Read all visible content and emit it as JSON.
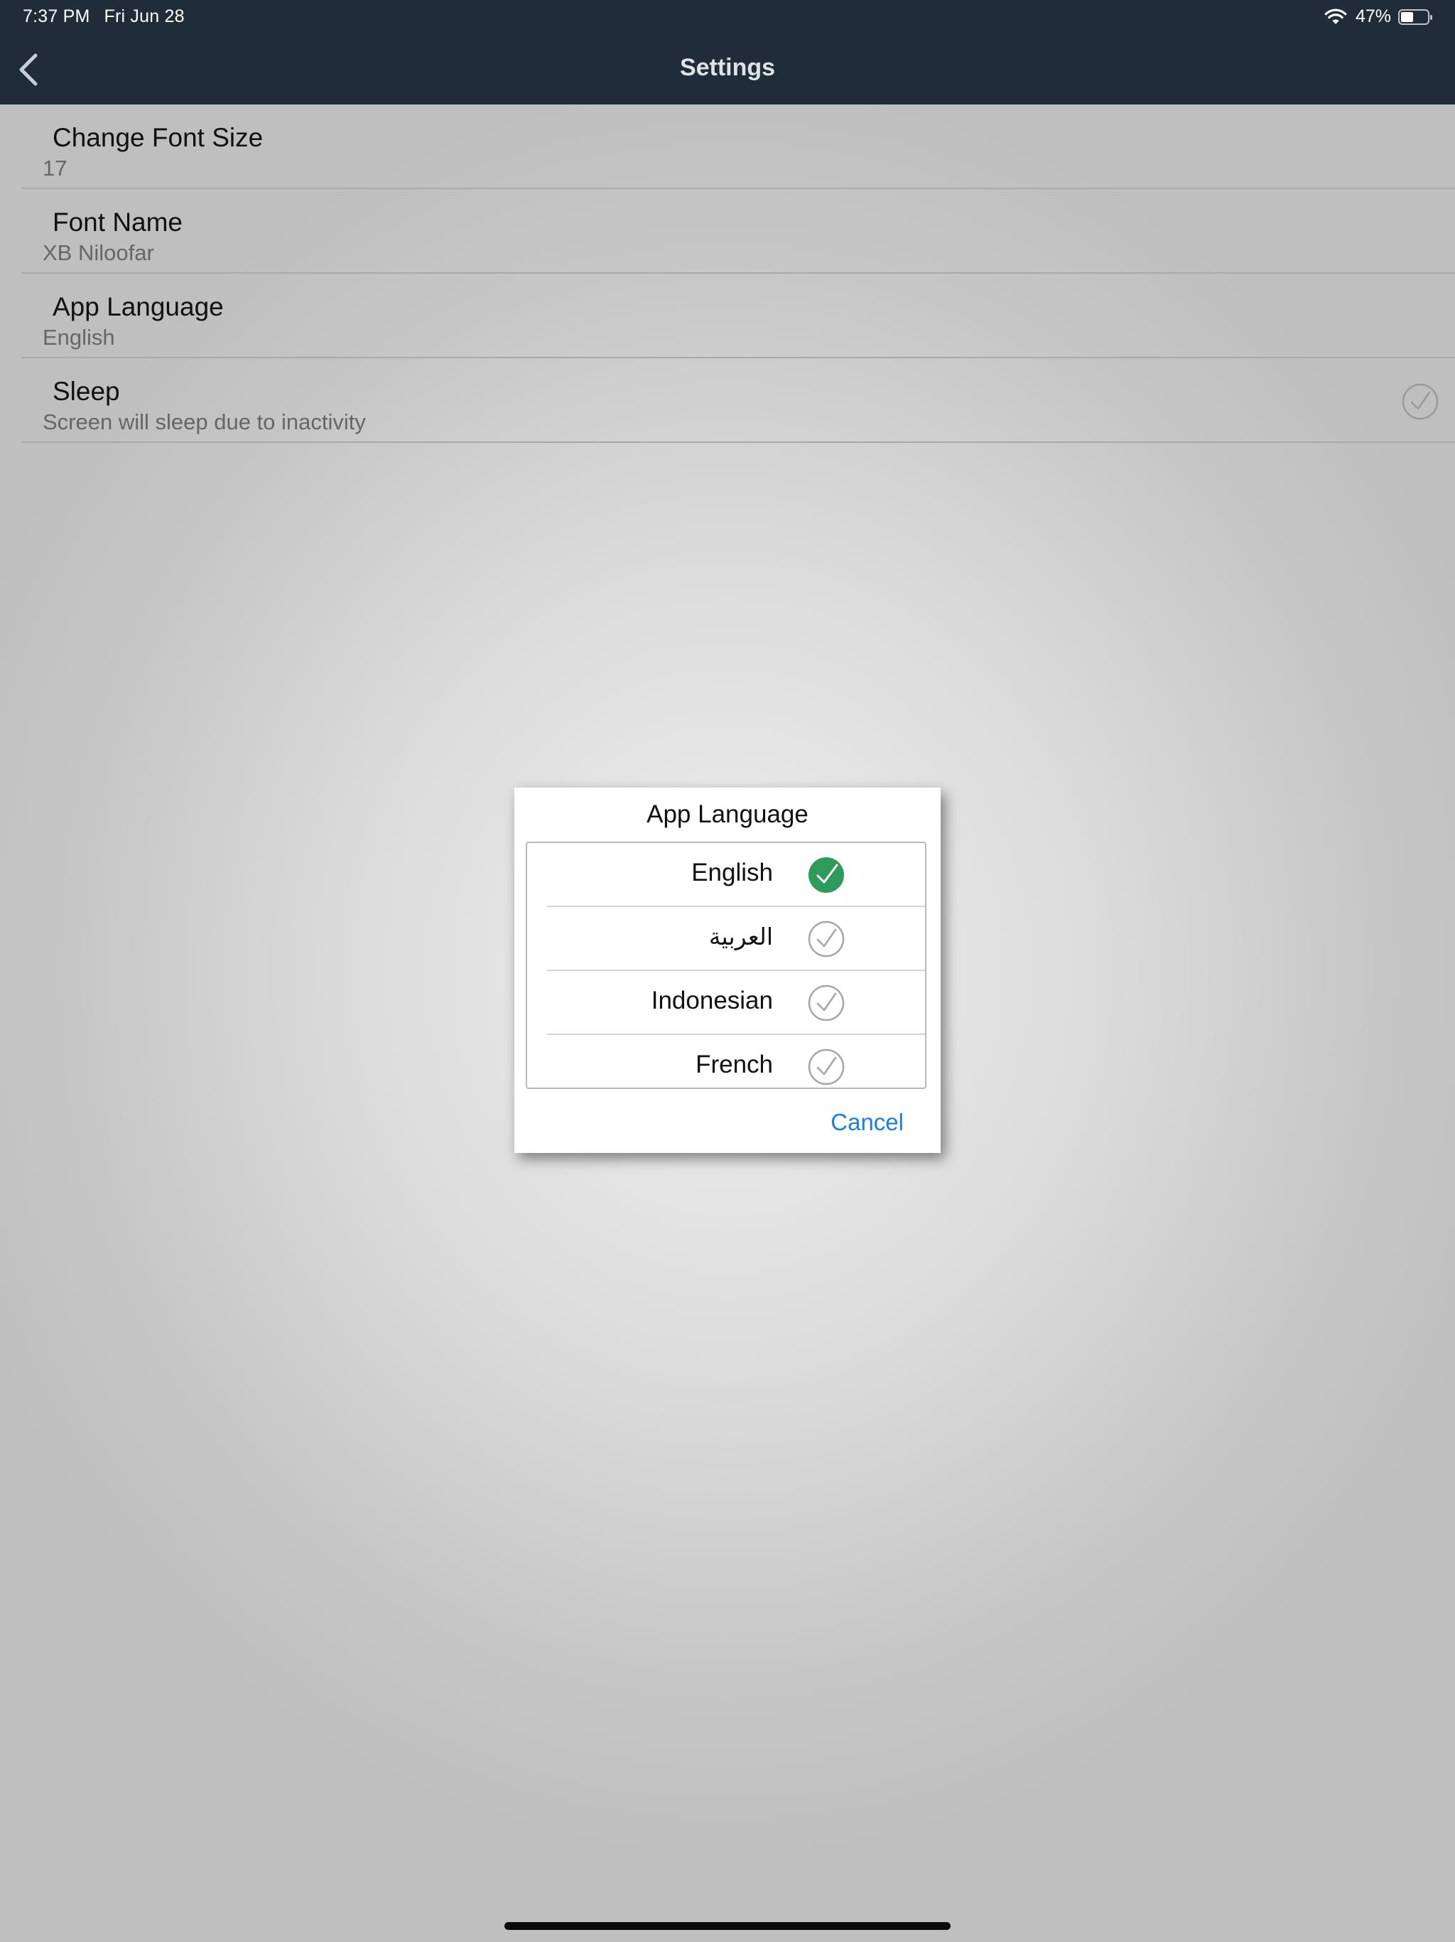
{
  "status_bar": {
    "time": "7:37 PM",
    "date": "Fri Jun 28",
    "battery": "47%"
  },
  "nav": {
    "title": "Settings",
    "back_icon": "chevron-left-icon"
  },
  "settings": {
    "font_size": {
      "title": "Change Font Size",
      "value": "17"
    },
    "font_name": {
      "title": "Font Name",
      "value": "XB Niloofar"
    },
    "app_language": {
      "title": "App Language",
      "value": "English"
    },
    "sleep": {
      "title": "Sleep",
      "value": "Screen will sleep due to inactivity",
      "checked": false
    }
  },
  "dialog": {
    "title": "App Language",
    "options": [
      {
        "label": "English",
        "selected": true
      },
      {
        "label": "العربية",
        "selected": false
      },
      {
        "label": "Indonesian",
        "selected": false
      },
      {
        "label": "French",
        "selected": false
      }
    ],
    "cancel_label": "Cancel"
  },
  "colors": {
    "header_bg": "#212c3a",
    "selected_check": "#2e9b5a",
    "link": "#1a7fe3"
  }
}
